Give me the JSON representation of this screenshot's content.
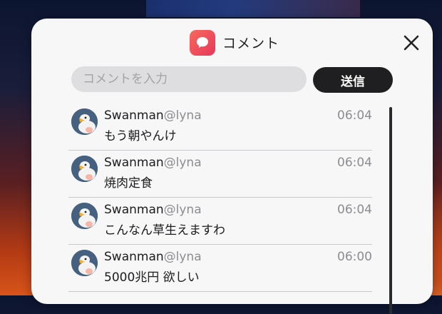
{
  "panel": {
    "title": "コメント",
    "app_icon": "chat-bubble-icon",
    "close_icon": "close-icon"
  },
  "composer": {
    "placeholder": "コメントを入力",
    "send_label": "送信"
  },
  "comments": [
    {
      "name": "Swanman",
      "handle": "@lyna",
      "time": "06:04",
      "text": "もう朝やんけ"
    },
    {
      "name": "Swanman",
      "handle": "@lyna",
      "time": "06:04",
      "text": "焼肉定食"
    },
    {
      "name": "Swanman",
      "handle": "@lyna",
      "time": "06:04",
      "text": "こんなん草生えますわ"
    },
    {
      "name": "Swanman",
      "handle": "@lyna",
      "time": "06:00",
      "text": "5000兆円 欲しい"
    }
  ],
  "colors": {
    "accent": "#e8375a",
    "send_button": "#1f1f22",
    "panel": "#f7f7f8"
  }
}
